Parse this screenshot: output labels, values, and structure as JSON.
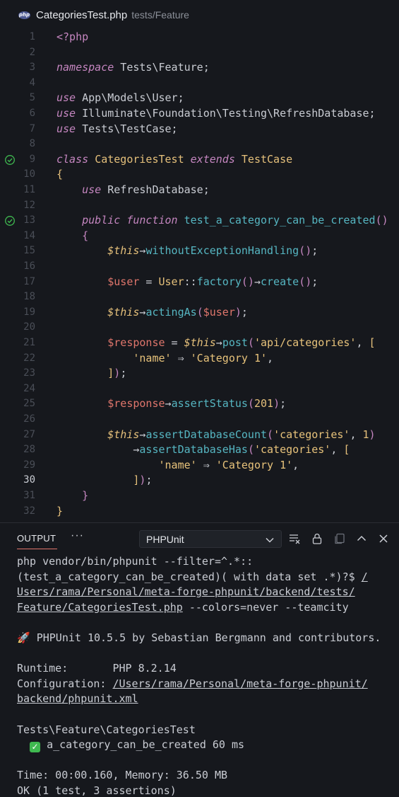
{
  "tab": {
    "file_icon": "php-file-icon",
    "file_icon_label": "php",
    "file_name": "CategoriesTest.php",
    "path": "tests/Feature"
  },
  "editor": {
    "active_line": 30,
    "lines": [
      {
        "n": "1",
        "tokens": [
          [
            "tag",
            "<?php"
          ]
        ]
      },
      {
        "n": "2",
        "tokens": []
      },
      {
        "n": "3",
        "tokens": [
          [
            "kw",
            "namespace"
          ],
          [
            "plain",
            " Tests\\Feature;"
          ]
        ]
      },
      {
        "n": "4",
        "tokens": []
      },
      {
        "n": "5",
        "tokens": [
          [
            "kw",
            "use"
          ],
          [
            "plain",
            " App\\Models\\User;"
          ]
        ]
      },
      {
        "n": "6",
        "tokens": [
          [
            "kw",
            "use"
          ],
          [
            "plain",
            " Illuminate\\Foundation\\Testing\\RefreshDatabase;"
          ]
        ]
      },
      {
        "n": "7",
        "tokens": [
          [
            "kw",
            "use"
          ],
          [
            "plain",
            " Tests\\TestCase;"
          ]
        ]
      },
      {
        "n": "8",
        "tokens": []
      },
      {
        "n": "9",
        "icon": "test-passed-icon",
        "tokens": [
          [
            "kw",
            "class"
          ],
          [
            "plain",
            " "
          ],
          [
            "class",
            "CategoriesTest"
          ],
          [
            "plain",
            " "
          ],
          [
            "kw",
            "extends"
          ],
          [
            "plain",
            " "
          ],
          [
            "class",
            "TestCase"
          ]
        ]
      },
      {
        "n": "10",
        "tokens": [
          [
            "brace",
            "{"
          ]
        ]
      },
      {
        "n": "11",
        "tokens": [
          [
            "plain",
            "    "
          ],
          [
            "kw",
            "use"
          ],
          [
            "plain",
            " RefreshDatabase;"
          ]
        ]
      },
      {
        "n": "12",
        "tokens": []
      },
      {
        "n": "13",
        "icon": "test-passed-icon",
        "tokens": [
          [
            "plain",
            "    "
          ],
          [
            "kw",
            "public"
          ],
          [
            "plain",
            " "
          ],
          [
            "kw",
            "function"
          ],
          [
            "plain",
            " "
          ],
          [
            "fn",
            "test_a_category_can_be_created"
          ],
          [
            "paren",
            "()"
          ]
        ]
      },
      {
        "n": "14",
        "tokens": [
          [
            "plain",
            "    "
          ],
          [
            "bracket",
            "{"
          ]
        ]
      },
      {
        "n": "15",
        "tokens": [
          [
            "plain",
            "        "
          ],
          [
            "this",
            "$this"
          ],
          [
            "op",
            "→"
          ],
          [
            "fn",
            "withoutExceptionHandling"
          ],
          [
            "paren",
            "()"
          ],
          [
            "punc",
            ";"
          ]
        ]
      },
      {
        "n": "16",
        "tokens": []
      },
      {
        "n": "17",
        "tokens": [
          [
            "plain",
            "        "
          ],
          [
            "var",
            "$user"
          ],
          [
            "op",
            " = "
          ],
          [
            "class",
            "User"
          ],
          [
            "op",
            "::"
          ],
          [
            "fn",
            "factory"
          ],
          [
            "paren",
            "()"
          ],
          [
            "op",
            "→"
          ],
          [
            "fn",
            "create"
          ],
          [
            "paren",
            "()"
          ],
          [
            "punc",
            ";"
          ]
        ]
      },
      {
        "n": "18",
        "tokens": []
      },
      {
        "n": "19",
        "tokens": [
          [
            "plain",
            "        "
          ],
          [
            "this",
            "$this"
          ],
          [
            "op",
            "→"
          ],
          [
            "fn",
            "actingAs"
          ],
          [
            "paren",
            "("
          ],
          [
            "var",
            "$user"
          ],
          [
            "paren",
            ")"
          ],
          [
            "punc",
            ";"
          ]
        ]
      },
      {
        "n": "20",
        "tokens": []
      },
      {
        "n": "21",
        "tokens": [
          [
            "plain",
            "        "
          ],
          [
            "var",
            "$response"
          ],
          [
            "op",
            " = "
          ],
          [
            "this",
            "$this"
          ],
          [
            "op",
            "→"
          ],
          [
            "fn",
            "post"
          ],
          [
            "paren",
            "("
          ],
          [
            "str",
            "'api/categories'"
          ],
          [
            "punc",
            ", "
          ],
          [
            "brace",
            "["
          ]
        ]
      },
      {
        "n": "22",
        "tokens": [
          [
            "plain",
            "            "
          ],
          [
            "str",
            "'name'"
          ],
          [
            "op",
            " ⇒ "
          ],
          [
            "str",
            "'Category 1'"
          ],
          [
            "punc",
            ","
          ]
        ]
      },
      {
        "n": "23",
        "tokens": [
          [
            "plain",
            "        "
          ],
          [
            "brace",
            "]"
          ],
          [
            "paren",
            ")"
          ],
          [
            "punc",
            ";"
          ]
        ]
      },
      {
        "n": "24",
        "tokens": []
      },
      {
        "n": "25",
        "tokens": [
          [
            "plain",
            "        "
          ],
          [
            "var",
            "$response"
          ],
          [
            "op",
            "→"
          ],
          [
            "fn",
            "assertStatus"
          ],
          [
            "paren",
            "("
          ],
          [
            "num",
            "201"
          ],
          [
            "paren",
            ")"
          ],
          [
            "punc",
            ";"
          ]
        ]
      },
      {
        "n": "26",
        "tokens": []
      },
      {
        "n": "27",
        "tokens": [
          [
            "plain",
            "        "
          ],
          [
            "this",
            "$this"
          ],
          [
            "op",
            "→"
          ],
          [
            "fn",
            "assertDatabaseCount"
          ],
          [
            "paren",
            "("
          ],
          [
            "str",
            "'categories'"
          ],
          [
            "punc",
            ", "
          ],
          [
            "num",
            "1"
          ],
          [
            "paren",
            ")"
          ]
        ]
      },
      {
        "n": "28",
        "tokens": [
          [
            "plain",
            "            "
          ],
          [
            "op",
            "→"
          ],
          [
            "fn",
            "assertDatabaseHas"
          ],
          [
            "paren",
            "("
          ],
          [
            "str",
            "'categories'"
          ],
          [
            "punc",
            ", "
          ],
          [
            "brace",
            "["
          ]
        ]
      },
      {
        "n": "29",
        "tokens": [
          [
            "plain",
            "                "
          ],
          [
            "str",
            "'name'"
          ],
          [
            "op",
            " ⇒ "
          ],
          [
            "str",
            "'Category 1'"
          ],
          [
            "punc",
            ","
          ]
        ]
      },
      {
        "n": "30",
        "tokens": [
          [
            "plain",
            "            "
          ],
          [
            "brace",
            "]"
          ],
          [
            "paren",
            ")"
          ],
          [
            "punc",
            ";"
          ]
        ]
      },
      {
        "n": "31",
        "tokens": [
          [
            "plain",
            "    "
          ],
          [
            "bracket",
            "}"
          ]
        ]
      },
      {
        "n": "32",
        "tokens": [
          [
            "brace",
            "}"
          ]
        ]
      }
    ]
  },
  "panel": {
    "tab_label": "OUTPUT",
    "more_label": "···",
    "channel": "PHPUnit",
    "icons": [
      "clear-output-icon",
      "lock-scroll-icon",
      "copy-icon",
      "maximize-panel-icon",
      "close-panel-icon"
    ],
    "output_lines": [
      [
        [
          "t",
          "php vendor/bin/phpunit --filter=^.*::"
        ]
      ],
      [
        [
          "t",
          "(test_a_category_can_be_created)( with data set .*)?$ "
        ],
        [
          "u",
          "/"
        ]
      ],
      [
        [
          "u",
          "Users/rama/Personal/meta-forge-phpunit/backend/tests/"
        ]
      ],
      [
        [
          "u",
          "Feature/CategoriesTest.php"
        ],
        [
          "t",
          " --colors=never --teamcity"
        ]
      ],
      [],
      [
        [
          "rocket",
          "🚀"
        ],
        [
          "t",
          " PHPUnit 10.5.5 by Sebastian Bergmann and contributors."
        ]
      ],
      [],
      [
        [
          "t",
          "Runtime:       PHP 8.2.14"
        ]
      ],
      [
        [
          "t",
          "Configuration: "
        ],
        [
          "u",
          "/Users/rama/Personal/meta-forge-phpunit/"
        ]
      ],
      [
        [
          "u",
          "backend/phpunit.xml"
        ]
      ],
      [],
      [
        [
          "t",
          "Tests\\Feature\\CategoriesTest"
        ]
      ],
      [
        [
          "t",
          "  "
        ],
        [
          "check",
          "✓"
        ],
        [
          "t",
          " a_category_can_be_created 60 ms"
        ]
      ],
      [],
      [
        [
          "t",
          "Time: 00:00.160, Memory: 36.50 MB"
        ]
      ],
      [
        [
          "t",
          "OK (1 test, 3 assertions)"
        ]
      ]
    ]
  },
  "colors": {
    "background": "#16181d",
    "keyword": "#c586c0",
    "class": "#e5c07b",
    "variable": "#e0766c",
    "function": "#56b6c2",
    "string": "#e8c37b",
    "pass": "#3fb950"
  }
}
